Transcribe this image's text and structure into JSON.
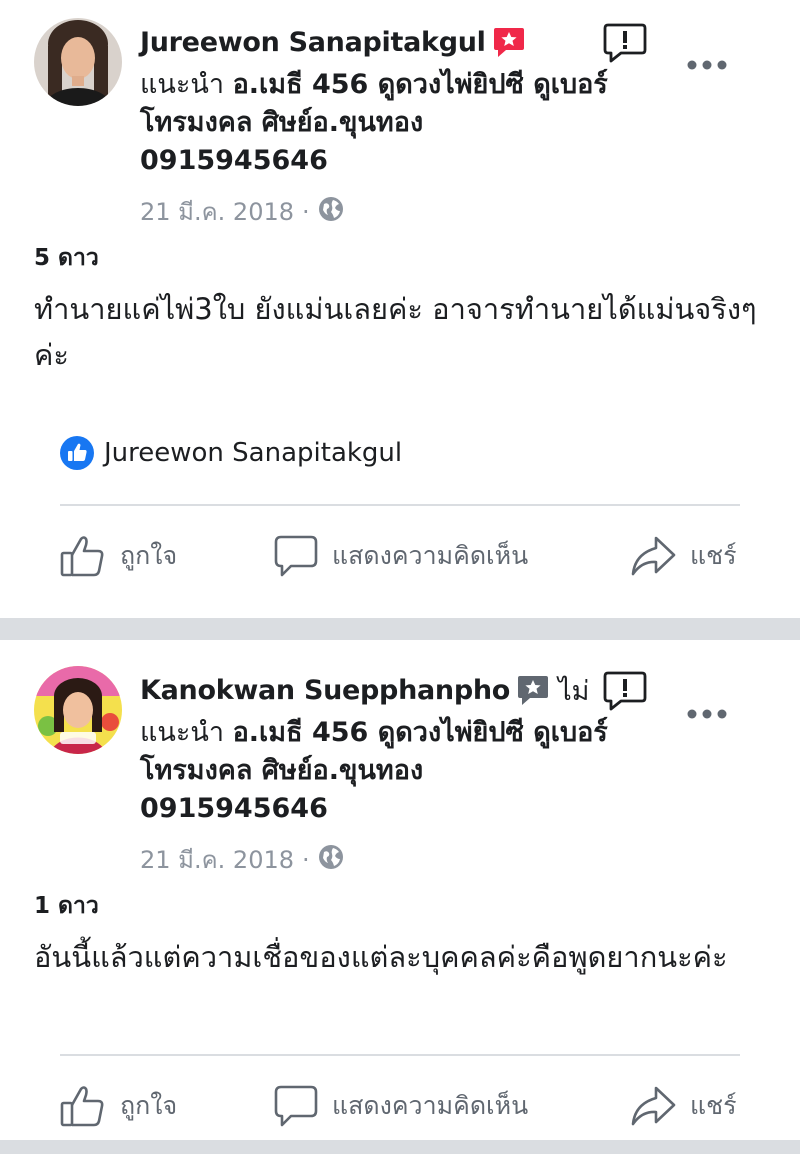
{
  "posts": [
    {
      "author": "Jureewon Sanapitakgul",
      "badge_suffix": "",
      "recommend_prefix": "แนะนำ",
      "page_name": "อ.เมธี 456 ดูดวงไพ่ยิปซี ดูเบอร์โทรมงคล ศิษย์อ.ขุนทอง 0915945646",
      "date": "21 มี.ค. 2018",
      "separator_dot": "·",
      "rating": "5 ดาว",
      "review": "ทำนายแค่ไพ่3ใบ ยังแม่นเลยค่ะ อาจารทำนายได้แม่นจริงๆค่ะ",
      "liker": "Jureewon Sanapitakgul",
      "actions": {
        "like": "ถูกใจ",
        "comment": "แสดงความคิดเห็น",
        "share": "แชร์"
      }
    },
    {
      "author": "Kanokwan Suepphanpho",
      "badge_suffix": "ไม่",
      "recommend_prefix": "แนะนำ",
      "page_name": "อ.เมธี 456 ดูดวงไพ่ยิปซี ดูเบอร์โทรมงคล ศิษย์อ.ขุนทอง 0915945646",
      "date": "21 มี.ค. 2018",
      "separator_dot": "·",
      "rating": "1 ดาว",
      "review": "อันนี้แล้วแต่ความเชื่อของแต่ละบุคคลค่ะคือพูดยากนะค่ะ",
      "actions": {
        "like": "ถูกใจ",
        "comment": "แสดงความคิดเห็น",
        "share": "แชร์"
      }
    }
  ],
  "colors": {
    "recommend_badge": "#f02849",
    "not_recommend_badge": "#606770",
    "like_blue": "#1877f2",
    "meta_gray": "#8d949e",
    "action_gray": "#606770",
    "separator": "#dadde1"
  },
  "icons": {
    "recommend": "star-speech-bubble-icon",
    "report": "report-flag-icon",
    "more": "more-dots-icon",
    "privacy": "globe-icon",
    "like_reaction": "thumbs-up-circle-icon",
    "like_action": "thumbs-up-outline-icon",
    "comment_action": "speech-bubble-icon",
    "share_action": "share-arrow-icon"
  }
}
